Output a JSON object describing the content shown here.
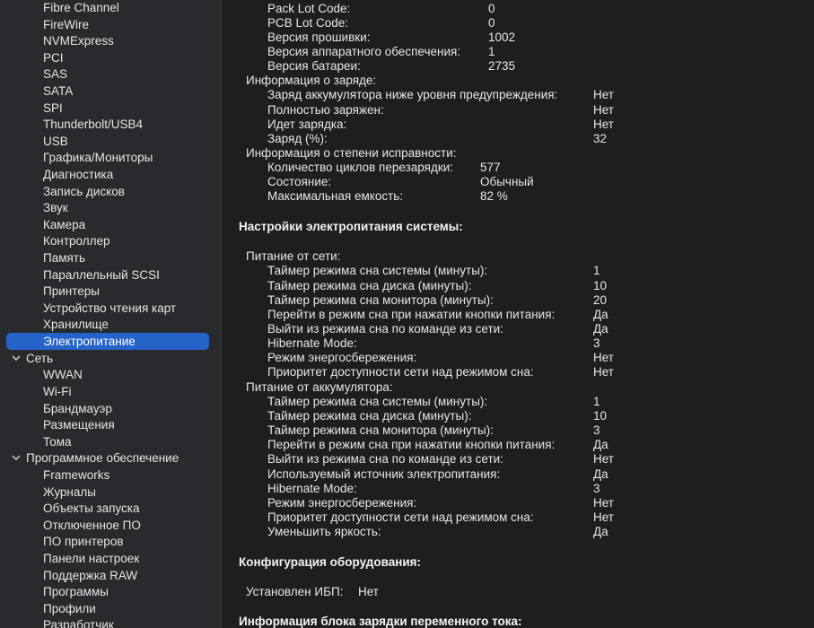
{
  "sidebar": {
    "items": [
      {
        "label": "Fibre Channel",
        "kind": "child"
      },
      {
        "label": "FireWire",
        "kind": "child"
      },
      {
        "label": "NVMExpress",
        "kind": "child"
      },
      {
        "label": "PCI",
        "kind": "child"
      },
      {
        "label": "SAS",
        "kind": "child"
      },
      {
        "label": "SATA",
        "kind": "child"
      },
      {
        "label": "SPI",
        "kind": "child"
      },
      {
        "label": "Thunderbolt/USB4",
        "kind": "child"
      },
      {
        "label": "USB",
        "kind": "child"
      },
      {
        "label": "Графика/Мониторы",
        "kind": "child"
      },
      {
        "label": "Диагностика",
        "kind": "child"
      },
      {
        "label": "Запись дисков",
        "kind": "child"
      },
      {
        "label": "Звук",
        "kind": "child"
      },
      {
        "label": "Камера",
        "kind": "child"
      },
      {
        "label": "Контроллер",
        "kind": "child"
      },
      {
        "label": "Память",
        "kind": "child"
      },
      {
        "label": "Параллельный SCSI",
        "kind": "child"
      },
      {
        "label": "Принтеры",
        "kind": "child"
      },
      {
        "label": "Устройство чтения карт",
        "kind": "child"
      },
      {
        "label": "Хранилище",
        "kind": "child"
      },
      {
        "label": "Электропитание",
        "kind": "child",
        "selected": true
      },
      {
        "label": "Сеть",
        "kind": "group"
      },
      {
        "label": "WWAN",
        "kind": "child"
      },
      {
        "label": "Wi-Fi",
        "kind": "child"
      },
      {
        "label": "Брандмауэр",
        "kind": "child"
      },
      {
        "label": "Размещения",
        "kind": "child"
      },
      {
        "label": "Тома",
        "kind": "child"
      },
      {
        "label": "Программное обеспечение",
        "kind": "group"
      },
      {
        "label": "Frameworks",
        "kind": "child"
      },
      {
        "label": "Журналы",
        "kind": "child"
      },
      {
        "label": "Объекты запуска",
        "kind": "child"
      },
      {
        "label": "Отключенное ПО",
        "kind": "child"
      },
      {
        "label": "ПО принтеров",
        "kind": "child"
      },
      {
        "label": "Панели настроек",
        "kind": "child"
      },
      {
        "label": "Поддержка RAW",
        "kind": "child"
      },
      {
        "label": "Программы",
        "kind": "child"
      },
      {
        "label": "Профили",
        "kind": "child"
      },
      {
        "label": "Разработчик",
        "kind": "child"
      }
    ]
  },
  "content": {
    "rows": [
      {
        "label": "Pack Lot Code:",
        "value": "0",
        "indent": 2,
        "vcol": "a"
      },
      {
        "label": "PCB Lot Code:",
        "value": "0",
        "indent": 2,
        "vcol": "a"
      },
      {
        "label": "Версия прошивки:",
        "value": "1002",
        "indent": 2,
        "vcol": "a"
      },
      {
        "label": "Версия аппаратного обеспечения:",
        "value": "1",
        "indent": 2,
        "vcol": "a"
      },
      {
        "label": "Версия батареи:",
        "value": "2735",
        "indent": 2,
        "vcol": "a"
      },
      {
        "label": "Информация о заряде:",
        "indent": 1
      },
      {
        "label": "Заряд аккумулятора ниже уровня предупреждения:",
        "value": "Нет",
        "indent": 2,
        "vcol": "b"
      },
      {
        "label": "Полностью заряжен:",
        "value": "Нет",
        "indent": 2,
        "vcol": "b"
      },
      {
        "label": "Идет зарядка:",
        "value": "Нет",
        "indent": 2,
        "vcol": "b"
      },
      {
        "label": "Заряд (%):",
        "value": "32",
        "indent": 2,
        "vcol": "b"
      },
      {
        "label": "Информация о степени исправности:",
        "indent": 1
      },
      {
        "label": "Количество циклов перезарядки:",
        "value": "577",
        "indent": 2,
        "vcol": "c"
      },
      {
        "label": "Состояние:",
        "value": "Обычный",
        "indent": 2,
        "vcol": "c"
      },
      {
        "label": "Максимальная емкость:",
        "value": "82 %",
        "indent": 2,
        "vcol": "c"
      },
      {
        "label": "Настройки электропитания системы:",
        "section": true
      },
      {
        "label": "Питание от сети:",
        "indent": 1
      },
      {
        "label": "Таймер режима сна системы (минуты):",
        "value": "1",
        "indent": 2,
        "vcol": "b"
      },
      {
        "label": "Таймер режима сна диска (минуты):",
        "value": "10",
        "indent": 2,
        "vcol": "b"
      },
      {
        "label": "Таймер режима сна монитора (минуты):",
        "value": "20",
        "indent": 2,
        "vcol": "b"
      },
      {
        "label": "Перейти в режим сна при нажатии кнопки питания:",
        "value": "Да",
        "indent": 2,
        "vcol": "b"
      },
      {
        "label": "Выйти из режима сна по команде из сети:",
        "value": "Да",
        "indent": 2,
        "vcol": "b"
      },
      {
        "label": "Hibernate Mode:",
        "value": "3",
        "indent": 2,
        "vcol": "b"
      },
      {
        "label": "Режим энергосбережения:",
        "value": "Нет",
        "indent": 2,
        "vcol": "b"
      },
      {
        "label": "Приоритет доступности сети над режимом сна:",
        "value": "Нет",
        "indent": 2,
        "vcol": "b"
      },
      {
        "label": "Питание от аккумулятора:",
        "indent": 1
      },
      {
        "label": "Таймер режима сна системы (минуты):",
        "value": "1",
        "indent": 2,
        "vcol": "b"
      },
      {
        "label": "Таймер режима сна диска (минуты):",
        "value": "10",
        "indent": 2,
        "vcol": "b"
      },
      {
        "label": "Таймер режима сна монитора (минуты):",
        "value": "3",
        "indent": 2,
        "vcol": "b"
      },
      {
        "label": "Перейти в режим сна при нажатии кнопки питания:",
        "value": "Да",
        "indent": 2,
        "vcol": "b"
      },
      {
        "label": "Выйти из режима сна по команде из сети:",
        "value": "Нет",
        "indent": 2,
        "vcol": "b"
      },
      {
        "label": "Используемый источник электропитания:",
        "value": "Да",
        "indent": 2,
        "vcol": "b"
      },
      {
        "label": "Hibernate Mode:",
        "value": "3",
        "indent": 2,
        "vcol": "b"
      },
      {
        "label": "Режим энергосбережения:",
        "value": "Нет",
        "indent": 2,
        "vcol": "b"
      },
      {
        "label": "Приоритет доступности сети над режимом сна:",
        "value": "Нет",
        "indent": 2,
        "vcol": "b"
      },
      {
        "label": "Уменьшить яркость:",
        "value": "Да",
        "indent": 2,
        "vcol": "b"
      },
      {
        "label": "Конфигурация оборудования:",
        "section": true
      },
      {
        "label": "Установлен ИБП:",
        "value": "Нет",
        "indent": 1,
        "vcol": "d"
      },
      {
        "label": "Информация блока зарядки переменного тока:",
        "section": true
      }
    ]
  }
}
